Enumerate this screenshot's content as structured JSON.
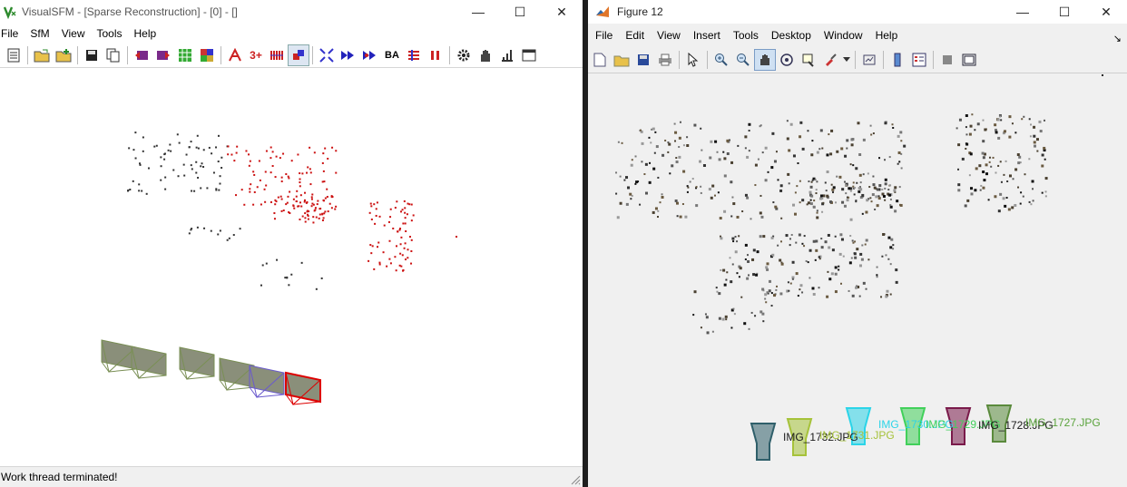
{
  "left_window": {
    "title": "VisualSFM - [Sparse Reconstruction] - [0] - []",
    "controls": {
      "minimize": "—",
      "maximize": "☐",
      "close": "✕"
    },
    "menu": [
      "File",
      "SfM",
      "View",
      "Tools",
      "Help"
    ],
    "toolbar_text": {
      "three_plus": "3+",
      "ba": "BA"
    },
    "status": "Work thread terminated!",
    "colors": {
      "points_gray": "#333333",
      "points_red": "#cc1111",
      "camera_green": "#7a8f55",
      "camera_purple": "#6a5acd",
      "camera_red": "#dd0000"
    }
  },
  "right_window": {
    "title": "Figure 12",
    "controls": {
      "minimize": "—",
      "maximize": "☐",
      "close": "✕"
    },
    "menu": [
      "File",
      "Edit",
      "View",
      "Insert",
      "Tools",
      "Desktop",
      "Window",
      "Help"
    ],
    "dock_arrow": "↘",
    "camera_labels": [
      {
        "text": "IMG_1732.JPG",
        "color": "#1a1a1a"
      },
      {
        "text": "IMG_1731.JPG",
        "color": "#a6c23a"
      },
      {
        "text": "IMG_1730.JPG",
        "color": "#2bd4e8"
      },
      {
        "text": "IMG_1729.JPG",
        "color": "#41d05a"
      },
      {
        "text": "IMG_1728.JPG",
        "color": "#1a1a1a"
      },
      {
        "text": "IMG_1727.JPG",
        "color": "#5aa33c"
      }
    ],
    "camera_colors": [
      "#2f5f6a",
      "#a6c23a",
      "#2bd4e8",
      "#41d05a",
      "#7a1a4a",
      "#5a8a3c"
    ]
  }
}
